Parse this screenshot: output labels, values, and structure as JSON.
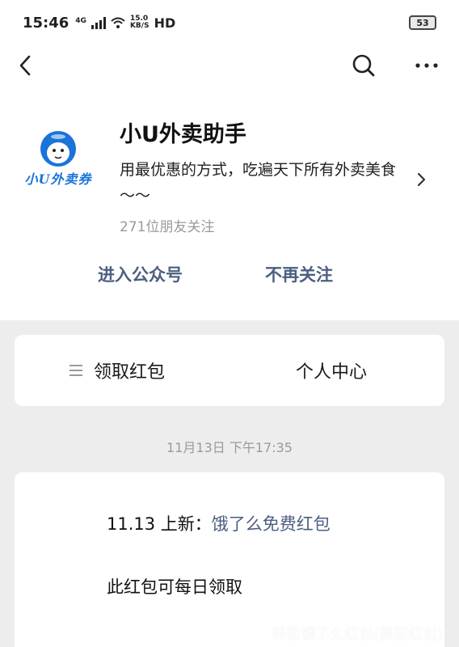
{
  "status_bar": {
    "time": "15:46",
    "network": "4G",
    "speed_value": "15.0",
    "speed_unit": "KB/S",
    "hd": "HD",
    "battery": "53"
  },
  "nav": {
    "back_icon": "chevron-left-icon",
    "search_icon": "search-icon",
    "more_icon": "more-horizontal-icon"
  },
  "profile": {
    "avatar_text": "小U外卖券",
    "name": "小U外卖助手",
    "description": "用最优惠的方式，吃遍天下所有外卖美食～～",
    "followers": "271位朋友关注",
    "enter_label": "进入公众号",
    "unfollow_label": "不再关注"
  },
  "menu": {
    "items": [
      {
        "label": "领取红包",
        "icon": "menu-lines-icon"
      },
      {
        "label": "个人中心"
      }
    ]
  },
  "timestamp": "11月13日 下午17:35",
  "message": {
    "prefix": "11.13 上新：",
    "link_text": "饿了么免费红包",
    "line2": "此红包可每日领取"
  },
  "watermark": "美团饿了么红包(美团红包)",
  "colors": {
    "link": "#4c5f80",
    "background": "#ededed",
    "card": "#ffffff",
    "muted": "#9a9a9a",
    "avatar_blue": "#1a73d9"
  }
}
